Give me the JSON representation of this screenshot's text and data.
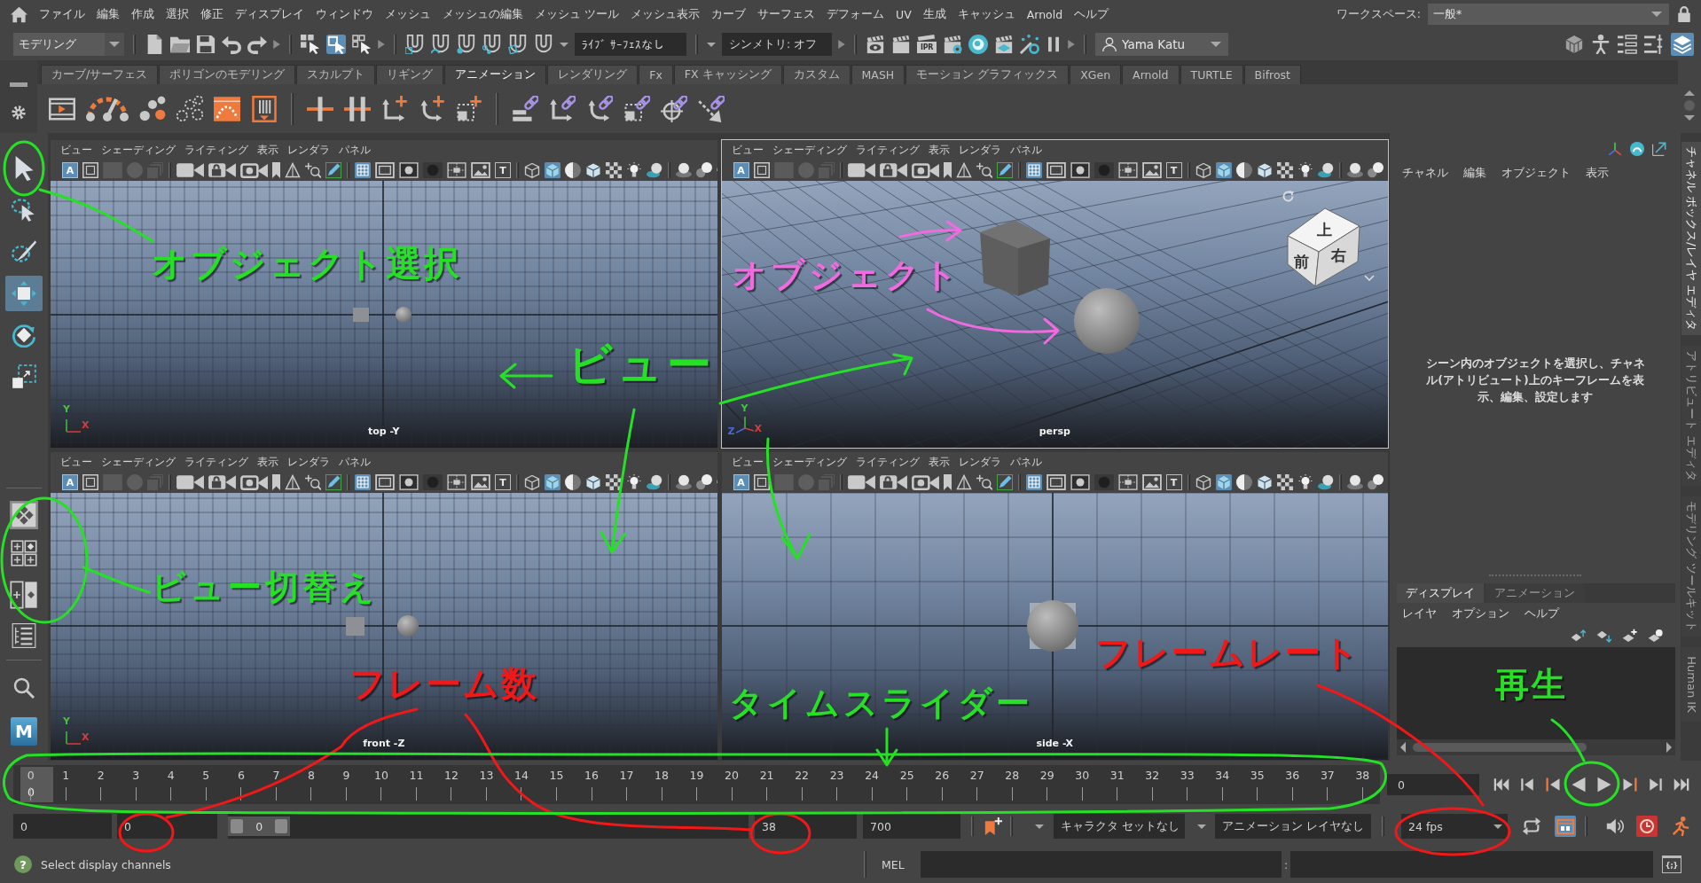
{
  "menu_bar": {
    "items": [
      "ファイル",
      "編集",
      "作成",
      "選択",
      "修正",
      "ディスプレイ",
      "ウィンドウ",
      "メッシュ",
      "メッシュの編集",
      "メッシュ ツール",
      "メッシュ表示",
      "カーブ",
      "サーフェス",
      "デフォーム",
      "UV",
      "生成",
      "キャッシュ",
      "Arnold",
      "ヘルプ"
    ],
    "workspace_label": "ワークスペース:",
    "workspace": "一般*"
  },
  "status_line": {
    "mode": "モデリング",
    "ipr_label": "IPR",
    "live_surface": "ﾗｲﾌﾞ ｻｰﾌｪｽなし",
    "symmetry": "シンメトリ: オフ",
    "user": "Yama Katu"
  },
  "shelf": {
    "tabs": [
      {
        "label": "カーブ/サーフェス",
        "selected": false
      },
      {
        "label": "ポリゴンのモデリング",
        "selected": false
      },
      {
        "label": "スカルプト",
        "selected": false
      },
      {
        "label": "リギング",
        "selected": false
      },
      {
        "label": "アニメーション",
        "selected": true
      },
      {
        "label": "レンダリング",
        "selected": false
      },
      {
        "label": "Fx",
        "selected": false
      },
      {
        "label": "FX キャッシング",
        "selected": false
      },
      {
        "label": "カスタム",
        "selected": false
      },
      {
        "label": "MASH",
        "selected": false
      },
      {
        "label": "モーション グラフィックス",
        "selected": false
      },
      {
        "label": "XGen",
        "selected": false
      },
      {
        "label": "Arnold",
        "selected": false
      },
      {
        "label": "TURTLE",
        "selected": false
      },
      {
        "label": "Bifrost",
        "selected": false
      }
    ]
  },
  "toolbox": {
    "tools": [
      {
        "selected": false
      },
      {
        "selected": false
      },
      {
        "selected": false
      },
      {
        "selected": true
      },
      {
        "selected": false
      },
      {
        "selected": false
      }
    ],
    "logo": "M"
  },
  "viewports": [
    {
      "kind": "top",
      "selected": false,
      "menus": [
        "ビュー",
        "シェーディング",
        "ライティング",
        "表示",
        "レンダラ",
        "パネル"
      ],
      "icon_letters": [
        "A",
        "T"
      ],
      "axis_labels": [
        {
          "text": "Y",
          "color": "#44c044"
        },
        {
          "text": "X",
          "color": "#d83c3c"
        }
      ],
      "camera_label": "top -Y"
    },
    {
      "kind": "persp",
      "selected": true,
      "menus": [
        "ビュー",
        "シェーディング",
        "ライティング",
        "表示",
        "レンダラ",
        "パネル"
      ],
      "icon_letters": [
        "A",
        "T"
      ],
      "view_cube": {
        "top": "上",
        "front": "前",
        "right": "右"
      },
      "axis_labels": [
        {
          "text": "Y",
          "color": "#44c044"
        },
        {
          "text": "Z",
          "color": "#4a6ad8"
        },
        {
          "text": "X",
          "color": "#d83c3c"
        }
      ],
      "camera_label": "persp"
    },
    {
      "kind": "front",
      "selected": false,
      "menus": [
        "ビュー",
        "シェーディング",
        "ライティング",
        "表示",
        "レンダラ",
        "パネル"
      ],
      "icon_letters": [
        "A",
        "T"
      ],
      "axis_labels": [
        {
          "text": "Y",
          "color": "#44c044"
        },
        {
          "text": "X",
          "color": "#d83c3c"
        }
      ],
      "camera_label": "front -Z"
    },
    {
      "kind": "side",
      "selected": false,
      "menus": [
        "ビュー",
        "シェーディング",
        "ライティング",
        "表示",
        "レンダラ",
        "パネル"
      ],
      "icon_letters": [
        "A",
        "T"
      ],
      "camera_label": "side -X"
    }
  ],
  "channel_box": {
    "menus": [
      "チャネル",
      "編集",
      "オブジェクト",
      "表示"
    ],
    "message": "シーン内のオブジェクトを選択し、チャネル(アトリビュート)上のキーフレームを表示、編集、設定します"
  },
  "layer_editor": {
    "tabs": [
      {
        "label": "ディスプレイ",
        "selected": true
      },
      {
        "label": "アニメーション",
        "selected": false
      }
    ],
    "menus": [
      "レイヤ",
      "オプション",
      "ヘルプ"
    ]
  },
  "side_tabs": [
    {
      "label": "チャネル ボックス/レイヤ エディタ",
      "selected": true
    },
    {
      "label": "アトリビュート エディタ",
      "selected": false
    },
    {
      "label": "モデリング ツールキット",
      "selected": false
    },
    {
      "label": "Human IK",
      "selected": false
    }
  ],
  "time_slider": {
    "frames": [
      "0",
      "1",
      "2",
      "3",
      "4",
      "5",
      "6",
      "7",
      "8",
      "9",
      "10",
      "11",
      "12",
      "13",
      "14",
      "15",
      "16",
      "17",
      "18",
      "19",
      "20",
      "21",
      "22",
      "23",
      "24",
      "25",
      "26",
      "27",
      "28",
      "29",
      "30",
      "31",
      "32",
      "33",
      "34",
      "35",
      "36",
      "37",
      "38"
    ],
    "level": 0,
    "current_frame": "0",
    "current_time": "0"
  },
  "playback_range": {
    "animation_start": "0",
    "playback_start": "0",
    "range_label": "0",
    "level": 0.12,
    "playback_end": "38",
    "animation_end": "700",
    "character_set": "キャラクタ セットなし",
    "animation_layer": "アニメーション レイヤなし",
    "frame_rate": "24 fps"
  },
  "command_line": {
    "help_mark": "?",
    "message": "Select display channels",
    "language": "MEL",
    "result_separator": ":",
    "script_icon_label": "{;}"
  },
  "annotations": [
    {
      "text": "オブジェクト選択",
      "color": "#26e026"
    },
    {
      "text": "ビュー",
      "color": "#26e026"
    },
    {
      "text": "オブジェクト",
      "color": "#f26ae0"
    },
    {
      "text": "ビュー切替え",
      "color": "#26e026"
    },
    {
      "text": "フレーム数",
      "color": "#f01818"
    },
    {
      "text": "タイムスライダー",
      "color": "#26e026"
    },
    {
      "text": "フレームレート",
      "color": "#f01818"
    },
    {
      "text": "再生",
      "color": "#26e026"
    }
  ]
}
